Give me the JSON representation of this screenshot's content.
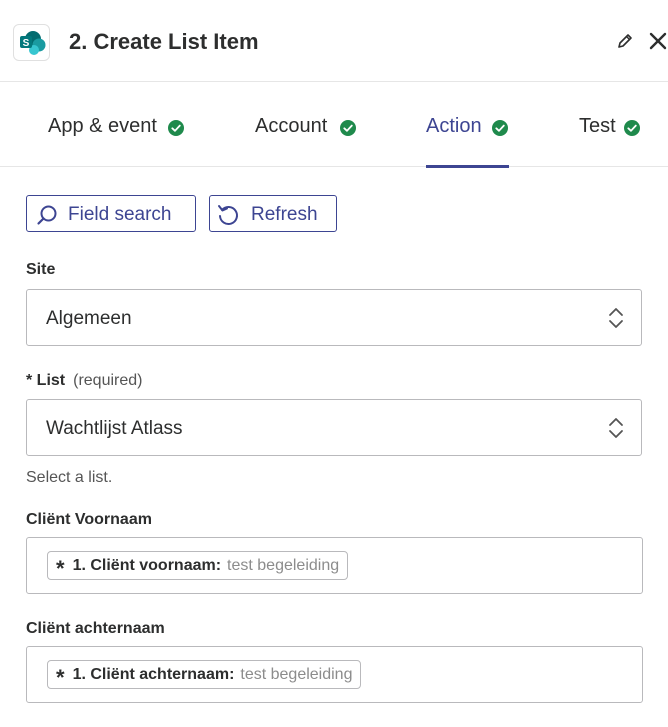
{
  "header": {
    "title": "2. Create List Item",
    "app_icon": "sharepoint-logo-icon"
  },
  "tabs": [
    {
      "label": "App & event",
      "status": "complete"
    },
    {
      "label": "Account",
      "status": "complete"
    },
    {
      "label": "Action",
      "status": "complete",
      "active": true
    },
    {
      "label": "Test",
      "status": "complete"
    }
  ],
  "toolbar": {
    "field_search_label": "Field search",
    "refresh_label": "Refresh"
  },
  "fields": {
    "site": {
      "label": "Site",
      "value": "Algemeen"
    },
    "list": {
      "label": "* List",
      "required_label": "(required)",
      "value": "Wachtlijst Atlass",
      "help": "Select a list."
    },
    "voornaam": {
      "label": "Cliënt Voornaam",
      "pill_step": "1. Cliënt voornaam:",
      "pill_sample": "test begeleiding"
    },
    "achternaam": {
      "label": "Cliënt achternaam",
      "pill_step": "1. Cliënt achternaam:",
      "pill_sample": "test begeleiding"
    }
  },
  "colors": {
    "accent": "#3d4592",
    "success": "#1f8a4c",
    "border": "#b9b9bc",
    "text": "#2d2e2e"
  }
}
